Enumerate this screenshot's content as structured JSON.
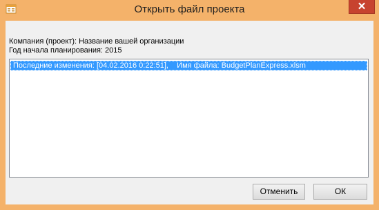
{
  "window": {
    "title": "Открыть файл проекта",
    "close_glyph": "✕",
    "icon": "app-window-icon",
    "accent_color": "#f4b26a",
    "close_color": "#c7432f"
  },
  "info": {
    "company_line": "Компания (проект): Название вашей организации",
    "year_line": "Год начала планирования: 2015"
  },
  "list": {
    "items": [
      {
        "text": "Последние изменения: [04.02.2016 0:22:51],    Имя файла: BudgetPlanExpress.xlsm",
        "selected": true
      }
    ],
    "selection_color": "#3399ff"
  },
  "buttons": {
    "cancel_label": "Отменить",
    "ok_label": "ОК"
  }
}
